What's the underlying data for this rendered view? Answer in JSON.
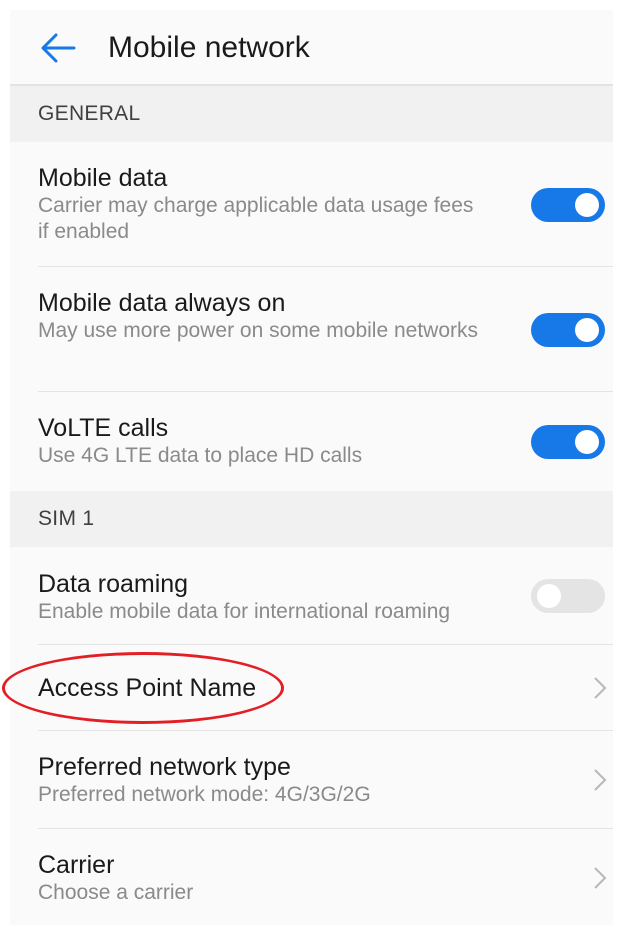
{
  "header": {
    "title": "Mobile network",
    "back_icon": "arrow-left-icon",
    "accent": "#1778e8"
  },
  "sections": {
    "general": {
      "label": "GENERAL",
      "items": [
        {
          "title": "Mobile data",
          "subtitle": "Carrier may charge applicable data usage fees if enabled",
          "toggle": true
        },
        {
          "title": "Mobile data always on",
          "subtitle": "May use more power on some mobile networks",
          "toggle": true
        },
        {
          "title": "VoLTE calls",
          "subtitle": "Use 4G LTE data to place HD calls",
          "toggle": true
        }
      ]
    },
    "sim1": {
      "label": "SIM 1",
      "items": [
        {
          "title": "Data roaming",
          "subtitle": "Enable mobile data for international roaming",
          "toggle": false
        },
        {
          "title": "Access Point Name"
        },
        {
          "title": "Preferred network type",
          "subtitle": "Preferred network mode: 4G/3G/2G"
        },
        {
          "title": "Carrier",
          "subtitle": "Choose a carrier"
        }
      ]
    }
  },
  "colors": {
    "toggle_on": "#1778e8",
    "toggle_off": "#e4e4e4",
    "annotation": "#e31e24"
  }
}
